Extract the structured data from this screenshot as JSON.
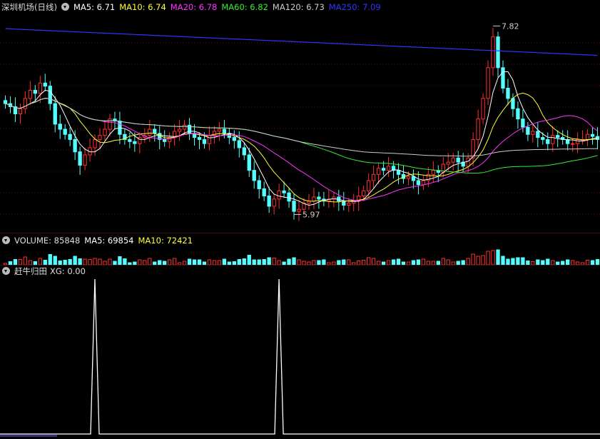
{
  "main": {
    "title": "深圳机场(日线)",
    "ma5": "MA5: 6.71",
    "ma10": "MA10: 6.74",
    "ma20": "MA20: 6.78",
    "ma60": "MA60: 6.82",
    "ma120": "MA120: 6.73",
    "ma250": "MA250: 7.09",
    "high_label": "7.82",
    "low_label": "5.97"
  },
  "volume": {
    "label": "VOLUME: 85848",
    "ma5": "MA5: 69854",
    "ma10": "MA10: 72421"
  },
  "indicator": {
    "name": "赶牛归田",
    "xg": "XG: 0.00"
  },
  "colors": {
    "up": "#ff3030",
    "down": "#54ffff",
    "ma5": "#ffffff",
    "ma10": "#ffff33",
    "ma20": "#ff33ff",
    "ma60": "#33ee33",
    "ma120": "#cccccc",
    "ma250": "#3333ff",
    "grid": "#5a1010"
  },
  "chart_data": [
    {
      "type": "candlestick",
      "title": "深圳机场(日线)",
      "ylim": [
        5.82,
        7.92
      ],
      "high": 7.82,
      "low": 5.97,
      "close_series": [
        7.05,
        7.02,
        6.95,
        7.0,
        7.1,
        7.18,
        7.15,
        7.25,
        7.22,
        7.05,
        6.85,
        6.8,
        6.75,
        6.7,
        6.58,
        6.45,
        6.55,
        6.62,
        6.7,
        6.74,
        6.8,
        6.9,
        6.88,
        6.75,
        6.7,
        6.68,
        6.66,
        6.72,
        6.74,
        6.8,
        6.76,
        6.7,
        6.68,
        6.72,
        6.78,
        6.8,
        6.84,
        6.76,
        6.72,
        6.7,
        6.66,
        6.74,
        6.78,
        6.8,
        6.76,
        6.72,
        6.69,
        6.62,
        6.55,
        6.4,
        6.3,
        6.22,
        6.15,
        6.05,
        6.12,
        6.2,
        6.18,
        6.1,
        6.0,
        6.02,
        6.08,
        6.1,
        6.14,
        6.12,
        6.1,
        6.12,
        6.14,
        6.1,
        6.06,
        6.08,
        6.1,
        6.15,
        6.2,
        6.3,
        6.36,
        6.42,
        6.4,
        6.44,
        6.4,
        6.36,
        6.32,
        6.34,
        6.3,
        6.26,
        6.3,
        6.36,
        6.4,
        6.38,
        6.46,
        6.48,
        6.52,
        6.48,
        6.44,
        6.52,
        6.7,
        6.9,
        7.1,
        7.4,
        7.7,
        7.4,
        7.2,
        7.1,
        7.0,
        6.9,
        6.82,
        6.75,
        6.78,
        6.72,
        6.7,
        6.66,
        6.74,
        6.72,
        6.7,
        6.66,
        6.66,
        6.7,
        6.7,
        6.75,
        6.73,
        6.7
      ],
      "xg_spikes": [
        18,
        55
      ]
    },
    {
      "type": "bar",
      "title": "VOLUME",
      "value": 85848,
      "ma5": 69854,
      "ma10": 72421
    },
    {
      "type": "line",
      "title": "赶牛归田",
      "series": [
        {
          "name": "XG",
          "value": 0.0
        }
      ]
    }
  ]
}
